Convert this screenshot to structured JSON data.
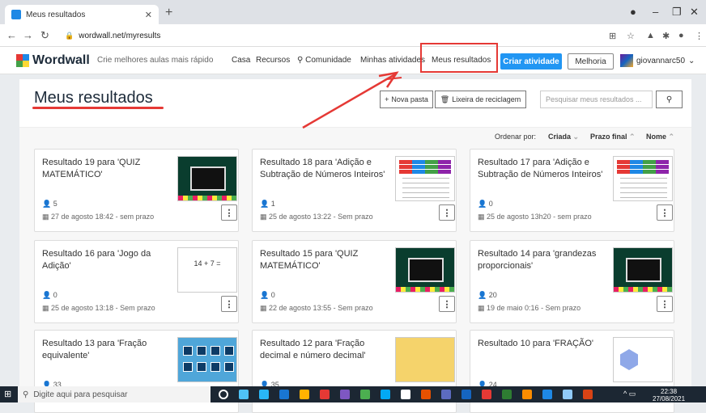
{
  "browser": {
    "tab_title": "Meus resultados",
    "url": "wordwall.net/myresults"
  },
  "site": {
    "logo": "Wordwall",
    "tagline": "Crie melhores aulas mais rápido",
    "nav": [
      "Casa",
      "Recursos",
      "Comunidade",
      "Minhas atividades",
      "Meus resultados"
    ],
    "create_button": "Criar atividade",
    "upgrade_button": "Melhoria",
    "username": "giovannarc50"
  },
  "page": {
    "title": "Meus resultados",
    "new_folder": "Nova pasta",
    "recycle_bin": "Lixeira de reciclagem",
    "search_placeholder": "Pesquisar meus resultados ...",
    "sort_label": "Ordenar por:",
    "sort_options": [
      "Criada",
      "Prazo final",
      "Nome"
    ]
  },
  "cards": [
    {
      "title": "Resultado 19 para 'QUIZ MATEMÁTICO'",
      "count": "5",
      "date": "27 de agosto 18:42 - sem prazo",
      "thumb": "quiz"
    },
    {
      "title": "Resultado 18 para 'Adição e Subtração de Números Inteiros'",
      "count": "1",
      "date": "25 de agosto 13:22 - Sem prazo",
      "thumb": "table"
    },
    {
      "title": "Resultado 17 para 'Adição e Subtração de Números Inteiros'",
      "count": "0",
      "date": "25 de agosto 13h20 - sem prazo",
      "thumb": "table"
    },
    {
      "title": "Resultado 16 para 'Jogo da Adição'",
      "count": "0",
      "date": "25 de agosto 13:18 - Sem prazo",
      "thumb": "add",
      "thumb_text": "14 + 7 ="
    },
    {
      "title": "Resultado 15 para 'QUIZ MATEMÁTICO'",
      "count": "0",
      "date": "22 de agosto 13:55 - Sem prazo",
      "thumb": "quiz"
    },
    {
      "title": "Resultado 14 para 'grandezas proporcionais'",
      "count": "20",
      "date": "19 de maio 0:16 - Sem prazo",
      "thumb": "quiz"
    },
    {
      "title": "Resultado 13 para 'Fração equivalente'",
      "count": "33",
      "date": "",
      "thumb": "frac",
      "thumb_numbers": [
        "1",
        "2",
        "3",
        "4",
        "5",
        "6",
        "7",
        "8"
      ]
    },
    {
      "title": "Resultado 12 para 'Fração decimal e número decimal'",
      "count": "35",
      "date": "",
      "thumb": "dec"
    },
    {
      "title": "Resultado 10 para 'FRAÇÃO'",
      "count": "24",
      "date": "",
      "thumb": "fr2"
    }
  ],
  "taskbar": {
    "search_placeholder": "Digite aqui para pesquisar",
    "time": "22:38",
    "date": "27/08/2021"
  },
  "colors": {
    "accent": "#2196f3",
    "annotation": "#e53935"
  }
}
